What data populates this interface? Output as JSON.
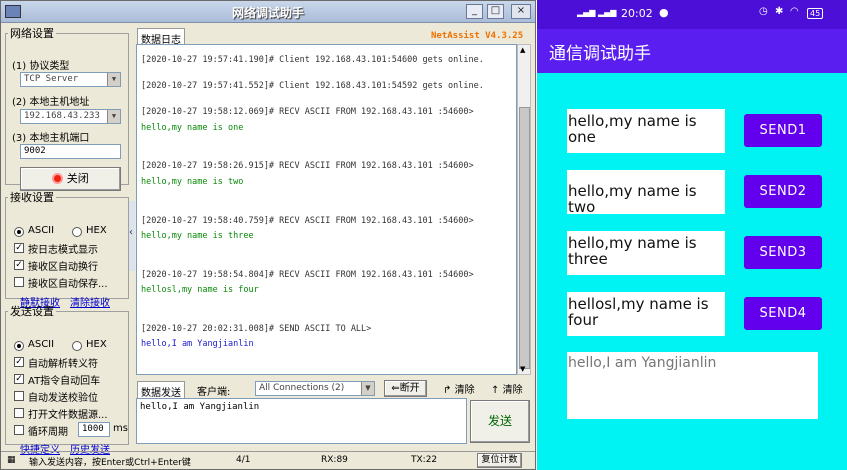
{
  "window": {
    "title": "网络调试助手",
    "minimize": "_",
    "maximize": "□",
    "close": "×"
  },
  "network": {
    "legend": "网络设置",
    "protocol_label": "(1) 协议类型",
    "protocol_value": "TCP Server",
    "host_label": "(2) 本地主机地址",
    "host_value": "192.168.43.233",
    "port_label": "(3) 本地主机端口",
    "port_value": "9002",
    "close_button": "关闭"
  },
  "receive": {
    "legend": "接收设置",
    "ascii": "ASCII",
    "hex": "HEX",
    "opt1": "按日志模式显示",
    "opt2": "接收区自动换行",
    "opt3": "接收区自动保存...",
    "silent_link": "静默接收",
    "clear_link": "清除接收"
  },
  "send": {
    "legend": "发送设置",
    "ascii": "ASCII",
    "hex": "HEX",
    "opt1": "自动解析转义符",
    "opt2": "AT指令自动回车",
    "opt3": "自动发送校验位",
    "opt4": "打开文件数据源...",
    "opt5": "循环周期",
    "period_value": "1000",
    "period_unit": "ms",
    "shortcut_link": "快捷定义",
    "history_link": "历史发送"
  },
  "log": {
    "tab_label": "数据日志",
    "brand": "NetAssist V4.3.25",
    "entries": [
      {
        "header": "[2020-10-27 19:57:41.190]# Client 192.168.43.101:54600 gets online.",
        "body": ""
      },
      {
        "header": "[2020-10-27 19:57:41.552]# Client 192.168.43.101:54592 gets online.",
        "body": ""
      },
      {
        "header": "[2020-10-27 19:58:12.069]# RECV ASCII FROM 192.168.43.101 :54600>",
        "body": "hello,my name is one"
      },
      {
        "header": "[2020-10-27 19:58:26.915]# RECV ASCII FROM 192.168.43.101 :54600>",
        "body": "hello,my name is two"
      },
      {
        "header": "[2020-10-27 19:58:40.759]# RECV ASCII FROM 192.168.43.101 :54600>",
        "body": "hello,my name is three"
      },
      {
        "header": "[2020-10-27 19:58:54.804]# RECV ASCII FROM 192.168.43.101 :54600>",
        "body": "hellosl,my name is four"
      },
      {
        "header": "[2020-10-27 20:02:31.008]# SEND ASCII TO ALL>",
        "body": "hello,I am Yangjianlin"
      }
    ]
  },
  "sendbar": {
    "tab_label": "数据发送",
    "client_label": "客户端:",
    "client_value": "All Connections (2)",
    "disconnect": "断开",
    "clear1": "清除",
    "clear2": "清除",
    "send_text": "hello,I am Yangjianlin",
    "send_button": "发送"
  },
  "status": {
    "hint": "输入发送内容，按Enter或Ctrl+Enter键",
    "page": "4/1",
    "rx": "RX:89",
    "tx": "TX:22",
    "reset": "复位计数"
  },
  "phone": {
    "time": "20:02",
    "battery": "45",
    "app_title": "通信调试助手",
    "messages": [
      {
        "text": "hello,my name is one",
        "button": "SEND1"
      },
      {
        "text": "hello,my name is two",
        "button": "SEND2"
      },
      {
        "text": "hello,my name is three",
        "button": "SEND3"
      },
      {
        "text": "hellosl,my name is four",
        "button": "SEND4"
      }
    ],
    "input_text": "hello,I am Yangjianlin"
  }
}
